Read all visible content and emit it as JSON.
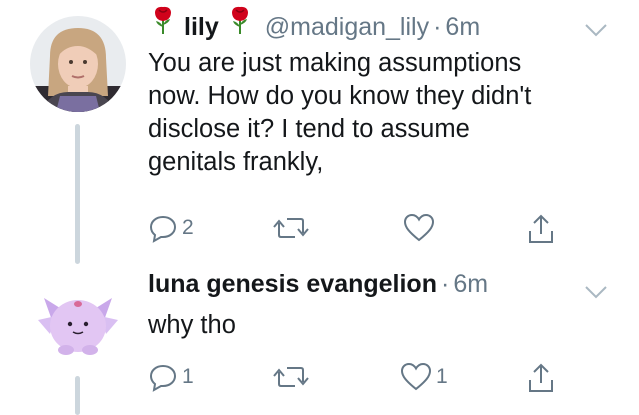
{
  "tweets": [
    {
      "name_prefix_emoji": "rose",
      "name": "lily",
      "name_suffix_emoji": "rose",
      "handle": "@madigan_lily",
      "separator": "·",
      "time": "6m",
      "text_lines": [
        "You are just making assumptions",
        "now. How do you know they didn't",
        "disclose it? I tend to assume",
        "genitals frankly,"
      ],
      "actions": {
        "replies": "2",
        "retweets": "",
        "likes": ""
      },
      "avatar_icon": "profile-photo"
    },
    {
      "name": "luna genesis evangelion",
      "separator": "·",
      "time": "6m",
      "text_lines": [
        "why tho"
      ],
      "actions": {
        "replies": "1",
        "retweets": "",
        "likes": "1"
      },
      "avatar_icon": "purple-creature-avatar"
    }
  ],
  "colors": {
    "text": "#14171a",
    "secondary": "#657786",
    "icon": "#657786",
    "thread_line": "#ccd6dd",
    "rose": "#d0021b"
  }
}
